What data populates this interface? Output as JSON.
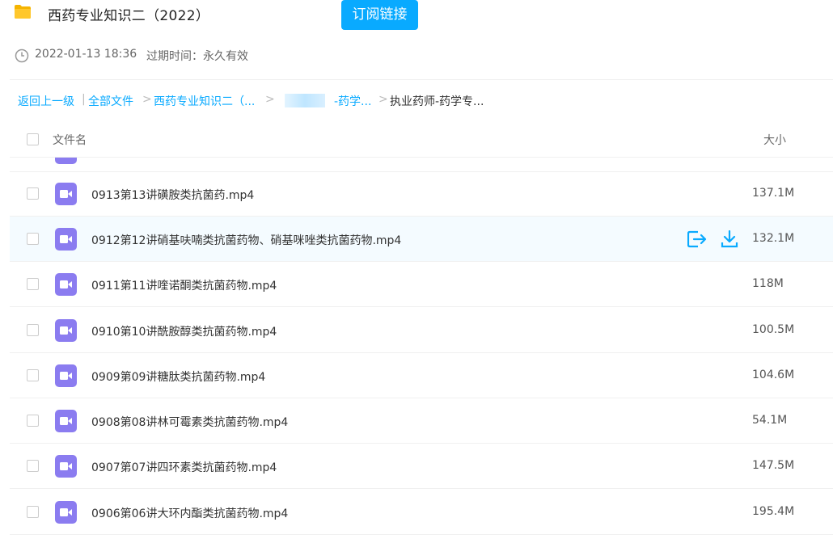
{
  "header": {
    "title": "西药专业知识二（2022）",
    "subscribe_label": "订阅链接",
    "accent_color": "#09aaff"
  },
  "meta": {
    "date": "2022-01-13 18:36",
    "expire": "过期时间：永久有效"
  },
  "breadcrumb": {
    "back": "返回上一级",
    "sep_pipe": "|",
    "all_files": "全部文件",
    "sep": ">",
    "level1": "西药专业知识二（...",
    "level2": "-药学...",
    "current": "执业药师-药学专..."
  },
  "list": {
    "header_name": "文件名",
    "header_size": "大小",
    "files": [
      {
        "name": "0913第13讲磺胺类抗菌药.mp4",
        "size": "137.1M"
      },
      {
        "name": "0912第12讲硝基呋喃类抗菌药物、硝基咪唑类抗菌药物.mp4",
        "size": "132.1M"
      },
      {
        "name": "0911第11讲喹诺酮类抗菌药物.mp4",
        "size": "118M"
      },
      {
        "name": "0910第10讲酰胺醇类抗菌药物.mp4",
        "size": "100.5M"
      },
      {
        "name": "0909第09讲糖肽类抗菌药物.mp4",
        "size": "104.6M"
      },
      {
        "name": "0908第08讲林可霉素类抗菌药物.mp4",
        "size": "54.1M"
      },
      {
        "name": "0907第07讲四环素类抗菌药物.mp4",
        "size": "147.5M"
      },
      {
        "name": "0906第06讲大环内酯类抗菌药物.mp4",
        "size": "195.4M"
      }
    ]
  },
  "icons": {
    "file_type": "video-file-icon",
    "row_actions": [
      "share-icon",
      "download-icon"
    ],
    "video_icon_color": "#8b7cf0"
  }
}
